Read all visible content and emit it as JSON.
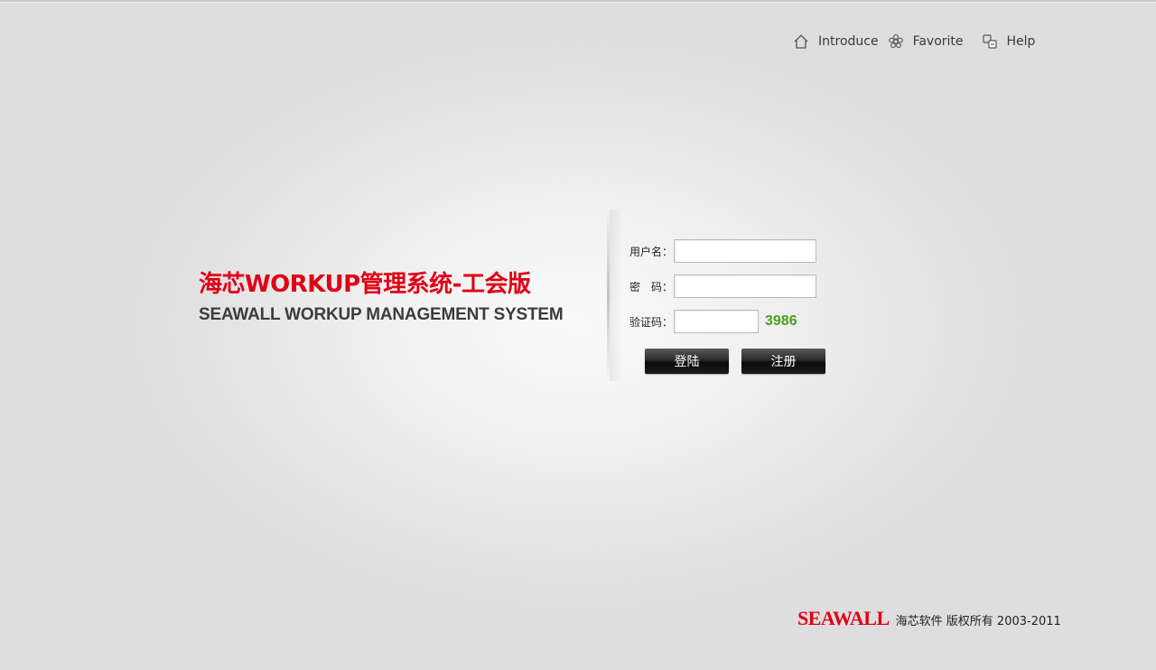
{
  "top_nav": {
    "items": [
      {
        "label": "Introduce",
        "icon": "home-icon"
      },
      {
        "label": "Favorite",
        "icon": "flower-icon"
      },
      {
        "label": "Help",
        "icon": "help-icon"
      }
    ]
  },
  "brand": {
    "title": "海芯WORKUP管理系统-工会版",
    "subtitle": "SEAWALL WORKUP MANAGEMENT SYSTEM"
  },
  "login_form": {
    "username_label": "用户名：",
    "username_value": "",
    "password_label": "密　码：",
    "password_value": "",
    "captcha_label": "验证码：",
    "captcha_value": "",
    "captcha_code": "3986",
    "login_button": "登陆",
    "register_button": "注册"
  },
  "footer": {
    "logo": "SEAWALL",
    "copyright": "海芯软件 版权所有 2003-2011"
  },
  "colors": {
    "brand_red": "#e00016",
    "captcha_green": "#4aa019",
    "button_dark": "#1a1a1a"
  }
}
